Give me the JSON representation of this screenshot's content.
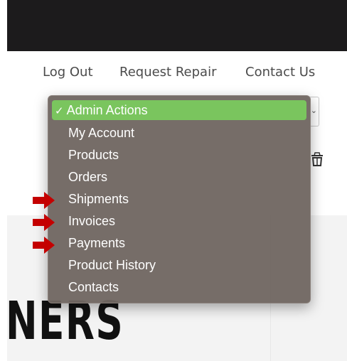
{
  "nav": {
    "logout": "Log Out",
    "request_repair": "Request Repair",
    "contact_us": "Contact Us"
  },
  "dropdown": {
    "selected": "Admin Actions",
    "items": [
      {
        "label": "Admin Actions",
        "selected": true
      },
      {
        "label": "My Account"
      },
      {
        "label": "Products"
      },
      {
        "label": "Orders"
      },
      {
        "label": "Shipments",
        "highlighted_by_arrow": true
      },
      {
        "label": "Invoices",
        "highlighted_by_arrow": true
      },
      {
        "label": "Payments",
        "highlighted_by_arrow": true
      },
      {
        "label": "Product History"
      },
      {
        "label": "Contacts"
      }
    ]
  },
  "hero": {
    "heading": "NERS"
  },
  "colors": {
    "top_bar": "#1c1b1c",
    "menu_background": "#706762",
    "selected_item": "#7ac55e",
    "arrow": "#c40000"
  },
  "icons": {
    "check": "check-icon",
    "cart": "basket-icon",
    "arrow": "red-arrow-icon"
  }
}
